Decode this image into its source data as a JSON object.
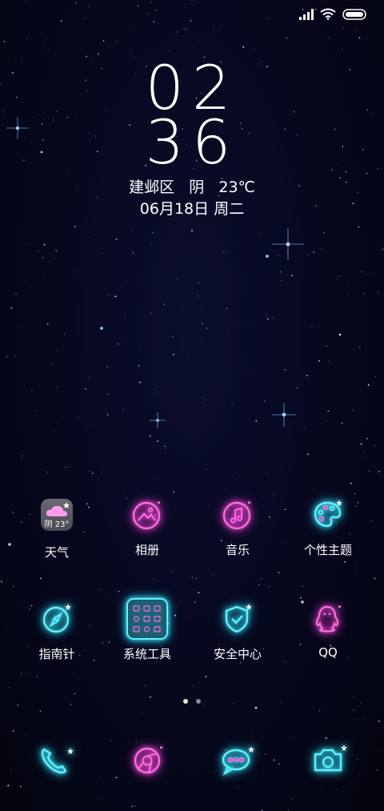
{
  "clock": {
    "hours": "02",
    "minutes": "36"
  },
  "weather": {
    "location": "建邺区",
    "condition": "阴",
    "temperature": "23℃"
  },
  "date": "06月18日 周二",
  "apps": [
    {
      "label": "天气",
      "icon": "weather-icon",
      "badge": "阴 23°"
    },
    {
      "label": "相册",
      "icon": "gallery-icon"
    },
    {
      "label": "音乐",
      "icon": "music-icon"
    },
    {
      "label": "个性主题",
      "icon": "theme-palette-icon"
    },
    {
      "label": "指南针",
      "icon": "compass-icon"
    },
    {
      "label": "系统工具",
      "icon": "system-tools-folder-icon"
    },
    {
      "label": "安全中心",
      "icon": "security-shield-icon"
    },
    {
      "label": "QQ",
      "icon": "qq-penguin-icon"
    }
  ],
  "dock": [
    {
      "icon": "phone-icon"
    },
    {
      "icon": "browser-icon"
    },
    {
      "icon": "messages-icon"
    },
    {
      "icon": "camera-icon"
    }
  ],
  "pager": {
    "pages": 2,
    "active": 1
  },
  "colors": {
    "neon_pink": "#ff4fd8",
    "neon_cyan": "#4ef0ff",
    "background": "#05061a"
  }
}
